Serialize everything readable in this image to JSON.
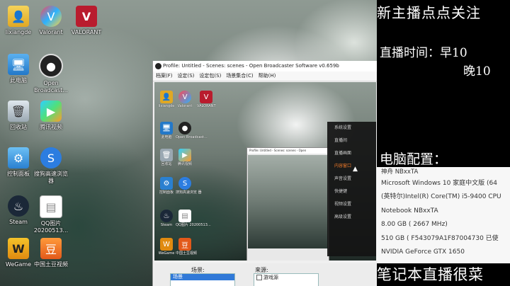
{
  "desktop": {
    "icons": [
      {
        "label": "lixiangde",
        "icon": "user-folder-icon"
      },
      {
        "label": "Valorant",
        "icon": "valorant-icon"
      },
      {
        "label": "VALORANT",
        "icon": "valorant-logo-icon"
      },
      {
        "label": "此电脑",
        "icon": "computer-icon"
      },
      {
        "label": "Open\nBroadcast...",
        "icon": "obs-icon"
      },
      {
        "label": "回收站",
        "icon": "recycle-bin-icon"
      },
      {
        "label": "腾讯视频",
        "icon": "tencent-video-icon"
      },
      {
        "label": "控制面板",
        "icon": "control-panel-icon"
      },
      {
        "label": "搜狗高速浏览\n器",
        "icon": "sogou-browser-icon"
      },
      {
        "label": "Steam",
        "icon": "steam-icon"
      },
      {
        "label": "QQ图片\n20200513...",
        "icon": "image-file-icon"
      },
      {
        "label": "WeGame",
        "icon": "wegame-icon"
      },
      {
        "label": "中国土豆视频",
        "icon": "tudou-icon"
      }
    ]
  },
  "obs": {
    "title": "Profile: Untitled - Scenes: scenes - Open Broadcaster Software v0.659b",
    "menu": [
      "档案(F)",
      "设定(S)",
      "设定包(S)",
      "场景集合(C)",
      "帮助(H)"
    ],
    "nested_title": "Profile: Untitled - Scenes: scenes - Open",
    "settings_menu": [
      "系统设置",
      "直播间",
      "直播画面",
      "内容窗口",
      "声音设置",
      "快捷键",
      "视频设置",
      "高级设置"
    ],
    "settings_active_index": 3,
    "scenes_label": "场景:",
    "scene_selected": "场景",
    "sources_label": "来源:",
    "source_item": "游戏源"
  },
  "overlay": {
    "title": "新主播点点关注",
    "time_line1": "直播时间：早10",
    "time_line2": "晚10",
    "config_label": "电脑配置：",
    "specs": [
      "神舟 NBxxTA",
      "Microsoft Windows 10 家庭中文版 (64",
      "(英特尔)Intel(R) Core(TM) i5-9400 CPU",
      "Notebook NBxxTA",
      "8.00 GB (  2667 MHz)",
      "510 GB ( F543079A1F87004730 已使",
      "NVIDIA GeForce GTX 1650"
    ],
    "footer": "笔记本直播很菜"
  }
}
